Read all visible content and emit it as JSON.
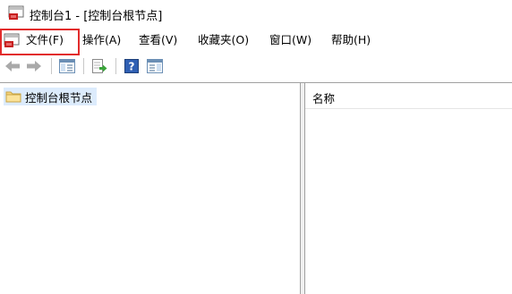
{
  "window": {
    "title": "控制台1 - [控制台根节点]",
    "icon": "mmc-console-icon"
  },
  "menu": {
    "items": [
      {
        "label": "文件(F)",
        "highlighted": true
      },
      {
        "label": "操作(A)"
      },
      {
        "label": "查看(V)"
      },
      {
        "label": "收藏夹(O)"
      },
      {
        "label": "窗口(W)"
      },
      {
        "label": "帮助(H)"
      }
    ],
    "highlight_color": "#e22b2b"
  },
  "toolbar": {
    "buttons": [
      {
        "icon": "back-arrow-icon",
        "enabled": false
      },
      {
        "icon": "forward-arrow-icon",
        "enabled": false
      },
      {
        "icon": "show-hide-console-tree-icon",
        "enabled": true
      },
      {
        "icon": "export-list-icon",
        "enabled": true
      },
      {
        "icon": "help-icon",
        "enabled": true
      },
      {
        "icon": "show-hide-action-pane-icon",
        "enabled": true
      }
    ]
  },
  "tree": {
    "root_label": "控制台根节点",
    "selected_bg": "#dcebfc"
  },
  "list": {
    "columns": [
      "名称"
    ]
  }
}
